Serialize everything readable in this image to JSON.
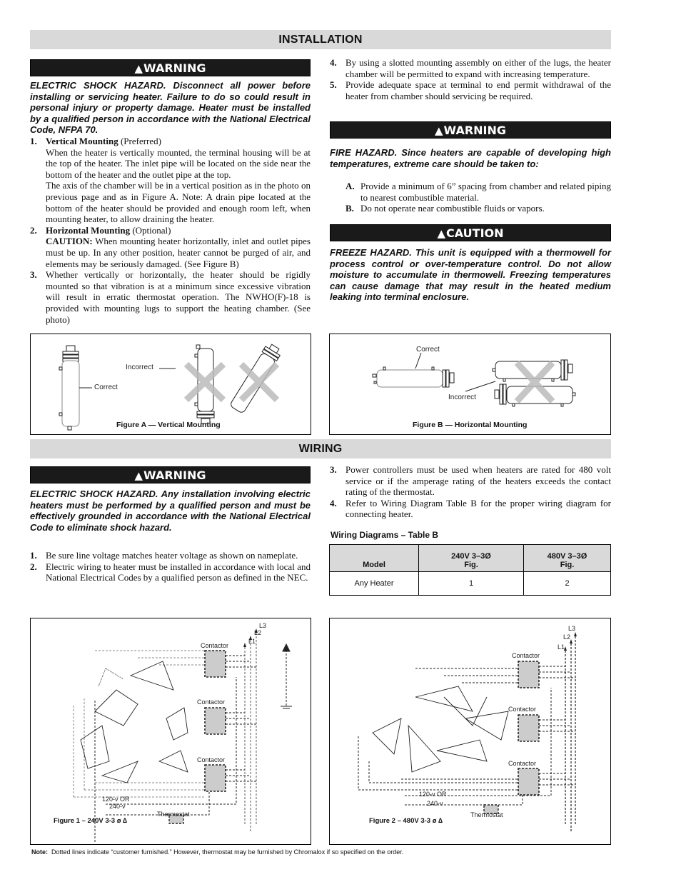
{
  "installation": {
    "title": "INSTALLATION",
    "warning1": {
      "label": "WARNING",
      "text": "ELECTRIC SHOCK HAZARD. Disconnect all power before installing or servicing heater. Failure to do so could result in personal injury or property damage. Heater must be installed by a qualified person in accordance with the National Electrical Code, NFPA 70."
    },
    "items": [
      {
        "num": "1.",
        "title": "Vertical Mounting",
        "qualifier": " (Preferred)",
        "paragraphs": [
          "When the heater is vertically mounted, the terminal housing will be at the top of the heater. The inlet pipe will be located on the side near the bottom of the heater and the outlet pipe at the top.",
          "The axis of the chamber will be in a vertical position as in the photo on previous page and as in Figure A. Note: A drain pipe located at the bottom of the heater should be provided and enough room left, when mounting heater, to allow draining the heater."
        ]
      },
      {
        "num": "2.",
        "title": "Horizontal Mounting",
        "qualifier": " (Optional)",
        "caution_label": "CAUTION:",
        "caution_text": " When mounting heater horizontally, inlet and outlet pipes must be up. In any other position, heater cannot be purged of air, and elements may be seriously damaged. (See Figure B)"
      },
      {
        "num": "3.",
        "text": "Whether vertically or horizontally, the heater should be rigidly mounted so that vibration is at a minimum since excessive vibration will result in erratic thermostat operation. The NWHO(F)-18 is provided with mounting lugs to support the heating chamber. (See photo)"
      },
      {
        "num": "4.",
        "text": "By using a slotted mounting assembly on either of the lugs, the heater chamber will be permitted to expand with increasing temperature."
      },
      {
        "num": "5.",
        "text": "Provide adequate space at terminal to end permit withdrawal of the heater from chamber should servicing be required."
      }
    ],
    "warning2": {
      "label": "WARNING",
      "text": "FIRE HAZARD. Since heaters are capable of developing high temperatures, extreme care should be taken to:",
      "subitems": [
        {
          "num": "A.",
          "text": "Provide a minimum of 6” spacing from chamber and related piping to nearest combustible material."
        },
        {
          "num": "B.",
          "text": "Do not operate near combustible fluids or vapors."
        }
      ]
    },
    "caution": {
      "label": "CAUTION",
      "text": "FREEZE HAZARD. This unit is equipped with a thermowell for process control or over-temperature control. Do not allow moisture to accumulate in thermowell. Freezing temperatures can cause damage that may result in the heated medium leaking into terminal enclosure."
    },
    "figure_a": {
      "caption": "Figure A — Vertical Mounting",
      "label_correct": "Correct",
      "label_incorrect": "Incorrect"
    },
    "figure_b": {
      "caption": "Figure B — Horizontal Mounting",
      "label_correct": "Correct",
      "label_incorrect": "Incorrect"
    }
  },
  "wiring": {
    "title": "WIRING",
    "warning": {
      "label": "WARNING",
      "text": "ELECTRIC SHOCK HAZARD. Any installation involving electric heaters must be performed by a qualified person and must be effectively grounded in accordance with the National Electrical Code to eliminate shock hazard."
    },
    "items": [
      {
        "num": "1.",
        "text": "Be sure line voltage matches heater voltage as shown on nameplate."
      },
      {
        "num": "2.",
        "text": "Electric wiring to heater must be installed in accordance with local and National Electrical Codes by a qualified person as defined in the NEC."
      },
      {
        "num": "3.",
        "text": "Power controllers must be used when heaters are rated for 480 volt service or if the amperage rating of the heaters exceeds the contact rating of the thermostat."
      },
      {
        "num": "4.",
        "text": "Refer to Wiring Diagram Table B for the proper wiring diagram for connecting heater."
      }
    ],
    "table": {
      "title": "Wiring Diagrams – Table B",
      "headers": [
        {
          "line1": "",
          "line2": "Model"
        },
        {
          "line1": "240V 3–3Ø",
          "line2": "Fig."
        },
        {
          "line1": "480V 3–3Ø",
          "line2": "Fig."
        }
      ],
      "rows": [
        [
          "Any Heater",
          "1",
          "2"
        ]
      ]
    },
    "figure1": {
      "caption": "Figure 1 – 240V 3-3 ø ∆",
      "contactor": "Contactor",
      "lines": [
        "L1",
        "L2",
        "L3"
      ],
      "supply_line1": "120-v OR",
      "supply_line2": "240-v",
      "thermostat": "Thermostat"
    },
    "figure2": {
      "caption": "Figure 2 – 480V 3-3 ø ∆",
      "contactor": "Contactor",
      "lines": [
        "L1",
        "L2",
        "L3"
      ],
      "supply_line1": "120-v OR",
      "supply_line2": "240-v",
      "thermostat": "Thermostat"
    },
    "note": {
      "label": "Note:",
      "text": "Dotted lines indicate “customer furnished.” However, thermostat may be furnished by Chromalox if so specified on the order."
    }
  },
  "icons": {
    "warning_triangle": "⚠"
  }
}
